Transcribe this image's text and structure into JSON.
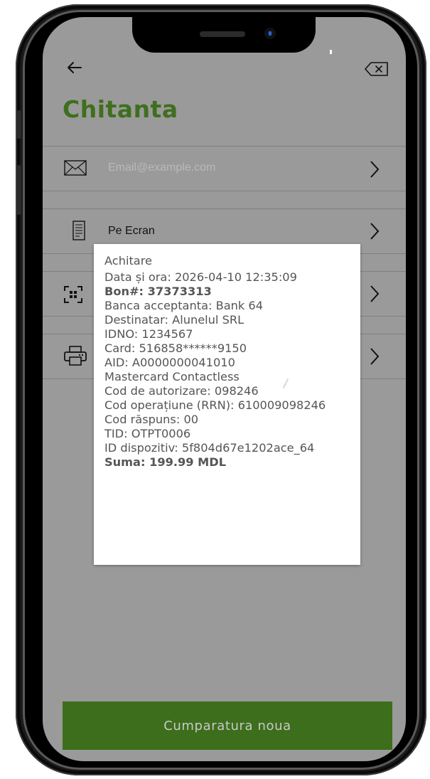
{
  "screen": {
    "title": "Chitanta",
    "options": [
      {
        "id": "email",
        "label": "Email@example.com",
        "icon": "envelope-icon"
      },
      {
        "id": "screen",
        "label": "Pe Ecran",
        "icon": "receipt-icon"
      },
      {
        "id": "qr",
        "label": "",
        "icon": "qr-scan-icon"
      },
      {
        "id": "print",
        "label": "",
        "icon": "printer-icon"
      }
    ],
    "new_purchase_label": "Cumparatura noua"
  },
  "receipt": {
    "lines": [
      "Achitare",
      "Data și ora: 2026-04-10 12:35:09",
      "Bon#: 37373313",
      "Banca acceptanta: Bank 64",
      "Destinatar: Alunelul SRL",
      "IDNO: 1234567",
      "Card: 516858******9150",
      "AID: A0000000041010",
      "Mastercard Contactless",
      "Cod de autorizare: 098246",
      "Cod operațiune (RRN): 610009098246",
      "Cod răspuns: 00",
      "TID: OTPT0006",
      "ID dispozitiv: 5f804d67e1202ace_64",
      "Suma: 199.99 MDL"
    ]
  },
  "colors": {
    "accent_green": "#3f6f1e",
    "button_green": "#3d6e1c",
    "dimmed_background": "#9a9a9a"
  }
}
